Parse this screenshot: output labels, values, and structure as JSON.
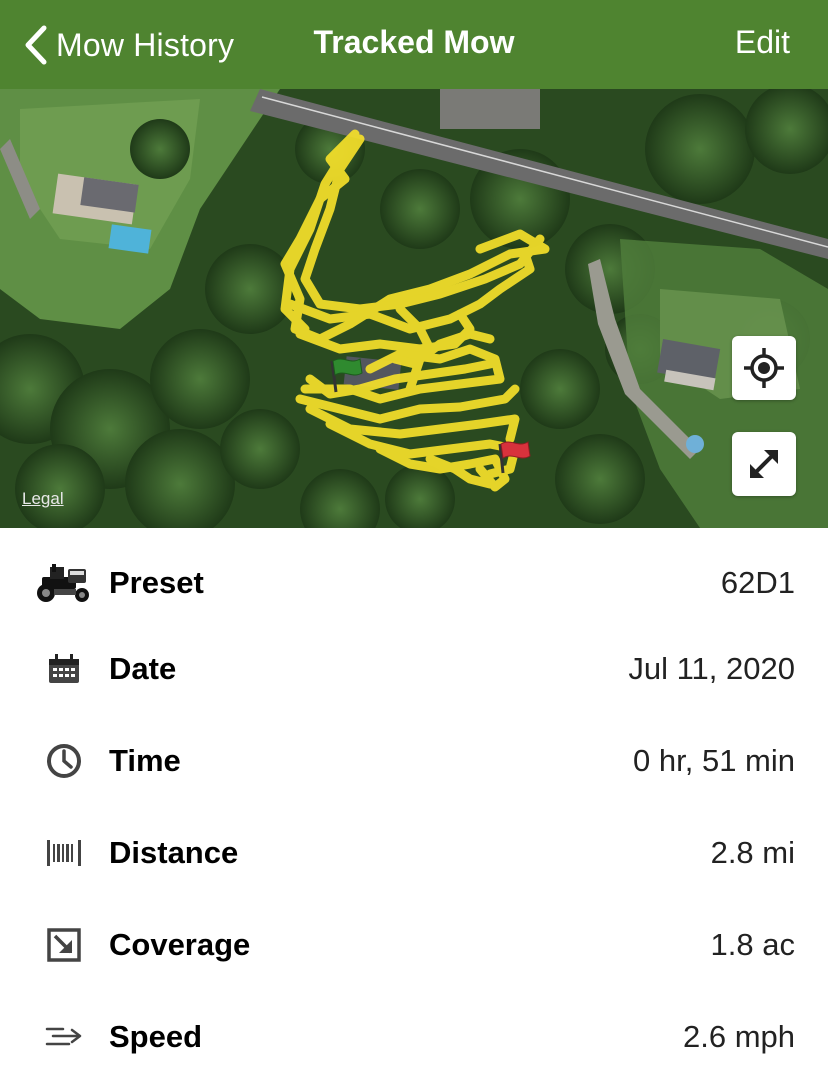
{
  "nav": {
    "back_label": "Mow History",
    "title": "Tracked Mow",
    "edit_label": "Edit"
  },
  "map": {
    "legal_label": "Legal",
    "track_color": "#f5e02a",
    "start_flag_color": "#2f8a2f",
    "end_flag_color": "#d8323c",
    "icons": [
      "locate-icon",
      "expand-icon"
    ]
  },
  "details": [
    {
      "icon": "tractor-icon",
      "label": "Preset",
      "value": "62D1"
    },
    {
      "icon": "calendar-icon",
      "label": "Date",
      "value": "Jul 11, 2020"
    },
    {
      "icon": "clock-icon",
      "label": "Time",
      "value": "0 hr, 51 min"
    },
    {
      "icon": "distance-icon",
      "label": "Distance",
      "value": "2.8 mi"
    },
    {
      "icon": "coverage-icon",
      "label": "Coverage",
      "value": "1.8 ac"
    },
    {
      "icon": "speed-icon",
      "label": "Speed",
      "value": "2.6 mph"
    }
  ],
  "colors": {
    "navbar": "#4f8430",
    "navbar_text": "#ffffff"
  }
}
